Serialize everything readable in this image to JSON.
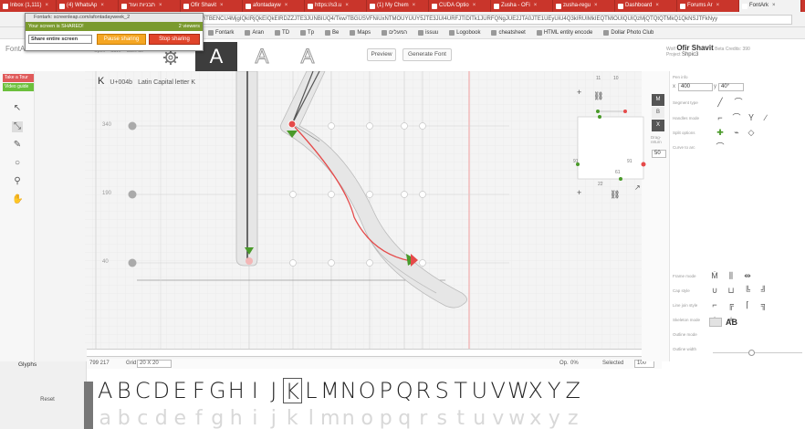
{
  "browser": {
    "tabs": [
      {
        "label": "Inbox (1,111)",
        "active": false
      },
      {
        "label": "(4) WhatsAp",
        "active": false
      },
      {
        "label": "תבניות ועוד",
        "active": false
      },
      {
        "label": "Ofir Shavit",
        "active": false
      },
      {
        "label": "afontadayw",
        "active": false
      },
      {
        "label": "https://s3.u",
        "active": false
      },
      {
        "label": "(1) My Chem",
        "active": false
      },
      {
        "label": "CUDA Optio",
        "active": false
      },
      {
        "label": "Zusha - OFi",
        "active": false
      },
      {
        "label": "zusha-regu",
        "active": false
      },
      {
        "label": "Dashboard",
        "active": false
      },
      {
        "label": "Forums Ar",
        "active": false
      },
      {
        "label": "FontArk",
        "active": true
      }
    ],
    "url": "ird=/iTBENCU4MjgIQkIRjQkEIQkEIRDZZJTE3JUNBIUQ4/Tkw/TBGUSVFNiUxNTMOUYUUY5JTE3JUI4URFJTIDlTk1JURFQNgJUE2JTA0JTE1UEyUiU4Q3kIRUIMkIEQTMlOUIQUIQzMjQTQtQTMkQ1QkNSJTFkNyy",
    "bookmarks": [
      "Fontark",
      "Aran",
      "TD",
      "Tp",
      "Be",
      "Maps",
      "המעלים",
      "issuu",
      "Logobook",
      "cheatsheet",
      "HTML entity encode",
      "Dollar Photo Club"
    ]
  },
  "share": {
    "title": "Fontark: screenleap.com/afontadayweek_2",
    "status": "Your screen is SHARED!",
    "viewers": "2 viewers",
    "select_value": "Share entire screen",
    "pause_label": "Pause sharing",
    "stop_label": "Stop sharing"
  },
  "app": {
    "logo": "FontArk",
    "header_mini": [
      "Open",
      "Save",
      "Save as"
    ],
    "preview_label": "Preview",
    "generate_label": "Generate Font",
    "user_prefix": "Wolf",
    "user_name": "Ofir Shavit",
    "user_credits": "Beta Credits: 390",
    "project_prefix": "Project",
    "project_name": "Shpic3"
  },
  "left": {
    "take_tour": "Take a Tour",
    "video_guide": "Video guide"
  },
  "glyph": {
    "letter": "K",
    "code": "U+004b",
    "name": "Latin Capital letter K",
    "y_labels": [
      "340",
      "190",
      "40"
    ]
  },
  "status": {
    "coords": "799  217",
    "grid_label": "Grid",
    "grid_value": "20 X 20",
    "opacity_label": "Op.",
    "opacity_value": "0%",
    "selected_label": "Selected",
    "zoom_value": "100"
  },
  "mini": {
    "top_values": [
      "11",
      "10"
    ],
    "side_values": [
      "91",
      "91"
    ],
    "bottom_values": [
      "22",
      "61"
    ],
    "drag_label": "Drag-return",
    "drag_value": "50"
  },
  "right": {
    "pen_info": "Pen info",
    "x_label": "x",
    "x_value": "400",
    "y_label": "y",
    "y_value": "40°",
    "segment_type": "Segment type",
    "handles_mode": "Handles mode",
    "split_options": "Split options",
    "curve_to_arc": "Curve to arc",
    "frame_mode": "Frame mode",
    "cap_style": "Cap style",
    "line_join_style": "Line join style",
    "skeleton_mode": "Skeleton mode",
    "outline_mode": "Outline mode",
    "outline_width": "Outline width",
    "outline_color": "#e2e2e2",
    "text_ab": "AB"
  },
  "strip": {
    "glyphs_tab": "Glyphs",
    "reset": "Reset",
    "upper": [
      "A",
      "B",
      "C",
      "D",
      "E",
      "F",
      "G",
      "H",
      "I",
      "J",
      "K",
      "L",
      "M",
      "N",
      "O",
      "P",
      "Q",
      "R",
      "S",
      "T",
      "U",
      "V",
      "W",
      "X",
      "Y",
      "Z"
    ],
    "lower": [
      "a",
      "b",
      "c",
      "d",
      "e",
      "f",
      "g",
      "h",
      "i",
      "j",
      "k",
      "l",
      "m",
      "n",
      "o",
      "p",
      "q",
      "r",
      "s",
      "t",
      "u",
      "v",
      "w",
      "x",
      "y",
      "z"
    ],
    "selected": "K"
  },
  "colors": {
    "tab_red": "#c9352b",
    "share_green": "#7a9a2e",
    "pause_orange": "#f5a623",
    "stop_red": "#e0442a",
    "take_tour": "#e05a5a",
    "video_guide": "#6cbf3c",
    "node_red": "#e54a4a",
    "handle_green": "#4a9a2a"
  }
}
